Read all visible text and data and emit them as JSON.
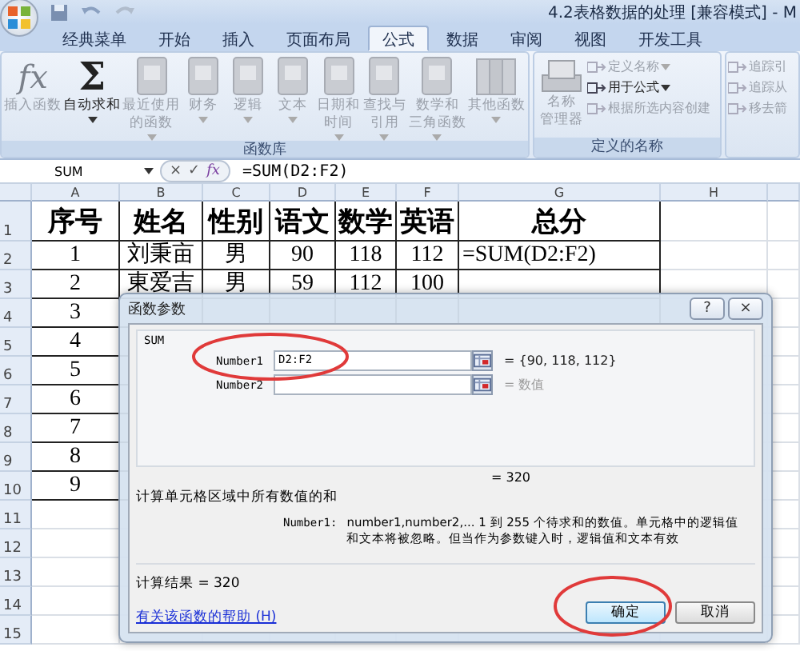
{
  "window": {
    "title": "4.2表格数据的处理  [兼容模式] - M"
  },
  "ribbon_tabs": [
    {
      "label": "经典菜单",
      "selected": false
    },
    {
      "label": "开始",
      "selected": false
    },
    {
      "label": "插入",
      "selected": false
    },
    {
      "label": "页面布局",
      "selected": false
    },
    {
      "label": "公式",
      "selected": true
    },
    {
      "label": "数据",
      "selected": false
    },
    {
      "label": "审阅",
      "selected": false
    },
    {
      "label": "视图",
      "selected": false
    },
    {
      "label": "开发工具",
      "selected": false
    }
  ],
  "ribbon_groups": [
    {
      "label": "函数库",
      "items": [
        {
          "kind": "glyph",
          "glyph": "fx",
          "lines": [
            "插入函数"
          ],
          "disabled": true,
          "dropdown": false
        },
        {
          "kind": "glyph",
          "glyph": "Σ",
          "lines": [
            "自动求和"
          ],
          "disabled": false,
          "dropdown": true
        },
        {
          "kind": "book",
          "lines": [
            "最近使用",
            "的函数"
          ],
          "disabled": true,
          "dropdown": true
        },
        {
          "kind": "book",
          "lines": [
            "财务"
          ],
          "disabled": true,
          "dropdown": true
        },
        {
          "kind": "book",
          "lines": [
            "逻辑"
          ],
          "disabled": true,
          "dropdown": true
        },
        {
          "kind": "book",
          "lines": [
            "文本"
          ],
          "disabled": true,
          "dropdown": true
        },
        {
          "kind": "book",
          "lines": [
            "日期和",
            "时间"
          ],
          "disabled": true,
          "dropdown": true
        },
        {
          "kind": "book",
          "lines": [
            "查找与",
            "引用"
          ],
          "disabled": true,
          "dropdown": true
        },
        {
          "kind": "book",
          "lines": [
            "数学和",
            "三角函数"
          ],
          "disabled": true,
          "dropdown": true
        },
        {
          "kind": "books",
          "lines": [
            "其他函数"
          ],
          "disabled": true,
          "dropdown": true
        }
      ]
    },
    {
      "label": "定义的名称",
      "items": [
        {
          "kind": "cards",
          "lines": [
            "名称",
            "管理器"
          ],
          "disabled": true,
          "dropdown": false
        },
        {
          "kind": "small",
          "lines": [
            "定义名称"
          ],
          "disabled": true,
          "dropdown": true
        },
        {
          "kind": "small",
          "lines": [
            "用于公式"
          ],
          "disabled": false,
          "dropdown": true
        },
        {
          "kind": "small",
          "lines": [
            "根据所选内容创建"
          ],
          "disabled": true,
          "dropdown": false
        }
      ]
    },
    {
      "items": [
        {
          "kind": "small",
          "lines": [
            "追踪引"
          ],
          "disabled": true,
          "dropdown": false
        },
        {
          "kind": "small",
          "lines": [
            "追踪从"
          ],
          "disabled": true,
          "dropdown": false
        },
        {
          "kind": "small",
          "lines": [
            "移去箭"
          ],
          "disabled": true,
          "dropdown": false
        }
      ]
    }
  ],
  "formula_bar": {
    "name_box": "SUM",
    "buttons": [
      "×",
      "✓",
      "fx"
    ],
    "formula": "=SUM(D2:F2)"
  },
  "sheet": {
    "columns": [
      "A",
      "B",
      "C",
      "D",
      "E",
      "F",
      "G",
      "H"
    ],
    "rows": [
      {
        "number": "1",
        "cells": [
          "序号",
          "姓名",
          "性别",
          "语文",
          "数学",
          "英语",
          "总分"
        ]
      },
      {
        "number": "2",
        "cells": [
          "1",
          "刘秉亩",
          "男",
          "90",
          "118",
          "112",
          "=SUM(D2:F2)"
        ]
      },
      {
        "number": "3",
        "cells": [
          "2",
          "東爱吉",
          "男",
          "59",
          "112",
          "100"
        ]
      },
      {
        "number": "4",
        "cells": [
          "3"
        ]
      },
      {
        "number": "5",
        "cells": [
          "4"
        ]
      },
      {
        "number": "6",
        "cells": [
          "5"
        ]
      },
      {
        "number": "7",
        "cells": [
          "6"
        ]
      },
      {
        "number": "8",
        "cells": [
          "7"
        ]
      },
      {
        "number": "9",
        "cells": [
          "8"
        ]
      },
      {
        "number": "10",
        "cells": [
          "9"
        ]
      },
      {
        "number": "11",
        "cells": []
      },
      {
        "number": "12",
        "cells": []
      },
      {
        "number": "13",
        "cells": []
      },
      {
        "number": "14",
        "cells": []
      },
      {
        "number": "15",
        "cells": []
      }
    ]
  },
  "dialog": {
    "title": "函数参数",
    "title_buttons": [
      "?",
      "×"
    ],
    "function_name": "SUM",
    "args": [
      {
        "label": "Number1",
        "value": "D2:F2",
        "result": "= {90, 118, 112}",
        "hint": false
      },
      {
        "label": "Number2",
        "result": "= 数值",
        "hint": true
      }
    ],
    "formula_result": "= 320",
    "description": "计算单元格区域中所有数值的和",
    "arg_help_label": "Number1:",
    "arg_help": [
      "number1,number2,...   1 到 255 个待求和的数值。单元格中的逻辑值",
      "和文本将被忽略。但当作为参数键入时，逻辑值和文本有效"
    ],
    "calc_result": "计算结果 =  320",
    "help_link": "有关该函数的帮助 (H)",
    "buttons": [
      {
        "label": "确定",
        "default": true
      },
      {
        "label": "取消",
        "default": false
      }
    ]
  }
}
